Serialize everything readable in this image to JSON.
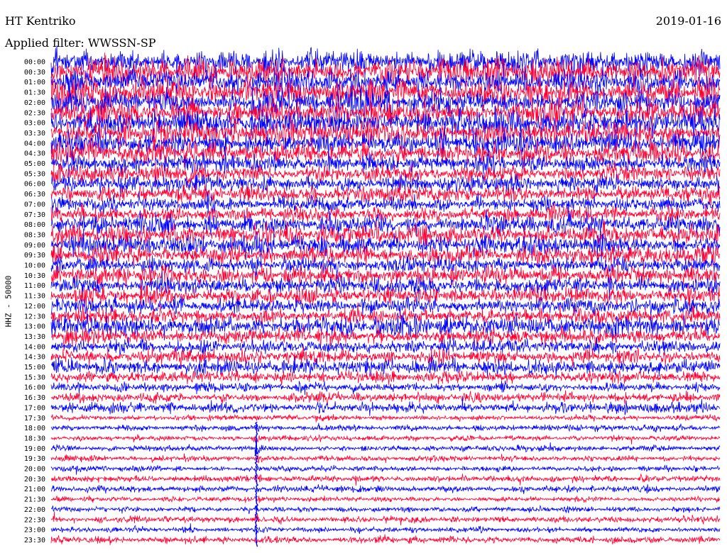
{
  "station": "HT Kentriko",
  "date": "2019-01-16",
  "filter_label": "Applied filter: WWSSN-SP",
  "channel_label": "HHZ - 50000",
  "colors": {
    "blue": "#0000ff",
    "red": "#ff0033",
    "text": "#000000"
  },
  "chart_data": {
    "type": "line",
    "plot_kind": "helicorder",
    "title": "HT Kentriko",
    "ylabel": "HHZ - 50000",
    "xlabel": "",
    "rows": [
      "00:00",
      "00:30",
      "01:00",
      "01:30",
      "02:00",
      "02:30",
      "03:00",
      "03:30",
      "04:00",
      "04:30",
      "05:00",
      "05:30",
      "06:00",
      "06:30",
      "07:00",
      "07:30",
      "08:00",
      "08:30",
      "09:00",
      "09:30",
      "10:00",
      "10:30",
      "11:00",
      "11:30",
      "12:00",
      "12:30",
      "13:00",
      "13:30",
      "14:00",
      "14:30",
      "15:00",
      "15:30",
      "16:00",
      "16:30",
      "17:00",
      "17:30",
      "18:00",
      "18:30",
      "19:00",
      "19:30",
      "20:00",
      "20:30",
      "21:00",
      "21:30",
      "22:00",
      "22:30",
      "23:00",
      "23:30"
    ],
    "row_colors": [
      "blue",
      "red"
    ],
    "row_duration_minutes": 30,
    "relative_noise_amplitude": [
      0.9,
      1.0,
      0.95,
      1.0,
      0.95,
      1.0,
      0.95,
      0.9,
      0.85,
      0.8,
      0.7,
      0.65,
      0.6,
      0.6,
      0.55,
      0.55,
      0.7,
      0.75,
      0.7,
      0.7,
      0.6,
      0.65,
      0.6,
      0.65,
      0.6,
      0.6,
      0.7,
      0.6,
      0.5,
      0.5,
      0.55,
      0.45,
      0.35,
      0.35,
      0.4,
      0.2,
      0.25,
      0.2,
      0.2,
      0.2,
      0.2,
      0.25,
      0.25,
      0.2,
      0.2,
      0.25,
      0.2,
      0.25
    ],
    "event": {
      "start_row": "18:00",
      "end_row": "23:30",
      "position_in_row": 0.307,
      "peak_row": "19:00"
    }
  }
}
